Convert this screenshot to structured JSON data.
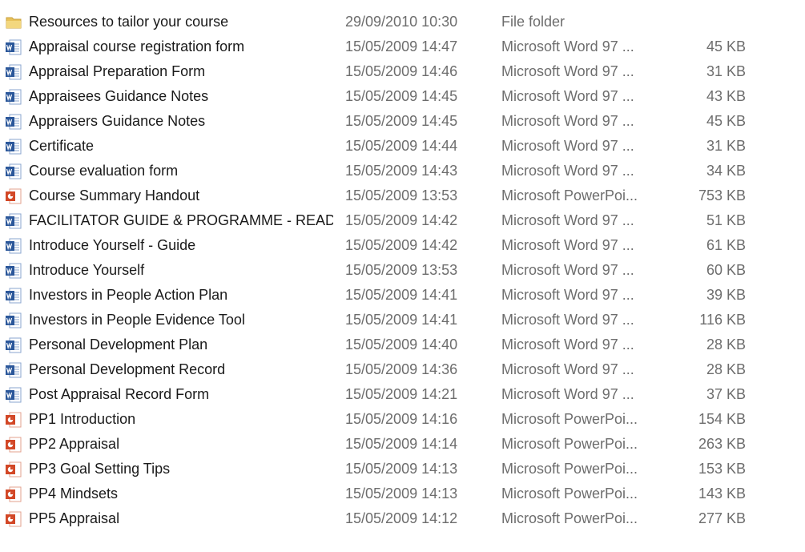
{
  "files": [
    {
      "name": "Resources to tailor your course",
      "date": "29/09/2010 10:30",
      "type": "File folder",
      "size": "",
      "icon": "folder-icon"
    },
    {
      "name": "Appraisal course registration form",
      "date": "15/05/2009 14:47",
      "type": "Microsoft Word 97 ...",
      "size": "45 KB",
      "icon": "word-doc-icon"
    },
    {
      "name": "Appraisal Preparation Form",
      "date": "15/05/2009 14:46",
      "type": "Microsoft Word 97 ...",
      "size": "31 KB",
      "icon": "word-doc-icon"
    },
    {
      "name": "Appraisees Guidance Notes",
      "date": "15/05/2009 14:45",
      "type": "Microsoft Word 97 ...",
      "size": "43 KB",
      "icon": "word-doc-icon"
    },
    {
      "name": "Appraisers Guidance Notes",
      "date": "15/05/2009 14:45",
      "type": "Microsoft Word 97 ...",
      "size": "45 KB",
      "icon": "word-doc-icon"
    },
    {
      "name": "Certificate",
      "date": "15/05/2009 14:44",
      "type": "Microsoft Word 97 ...",
      "size": "31 KB",
      "icon": "word-doc-icon"
    },
    {
      "name": "Course evaluation form",
      "date": "15/05/2009 14:43",
      "type": "Microsoft Word 97 ...",
      "size": "34 KB",
      "icon": "word-doc-icon"
    },
    {
      "name": "Course Summary Handout",
      "date": "15/05/2009 13:53",
      "type": "Microsoft PowerPoi...",
      "size": "753 KB",
      "icon": "powerpoint-icon"
    },
    {
      "name": "FACILITATOR GUIDE & PROGRAMME - READ...",
      "date": "15/05/2009 14:42",
      "type": "Microsoft Word 97 ...",
      "size": "51 KB",
      "icon": "word-doc-icon"
    },
    {
      "name": "Introduce Yourself - Guide",
      "date": "15/05/2009 14:42",
      "type": "Microsoft Word 97 ...",
      "size": "61 KB",
      "icon": "word-doc-icon"
    },
    {
      "name": "Introduce Yourself",
      "date": "15/05/2009 13:53",
      "type": "Microsoft Word 97 ...",
      "size": "60 KB",
      "icon": "word-doc-icon"
    },
    {
      "name": "Investors in People Action Plan",
      "date": "15/05/2009 14:41",
      "type": "Microsoft Word 97 ...",
      "size": "39 KB",
      "icon": "word-doc-icon"
    },
    {
      "name": "Investors in People Evidence Tool",
      "date": "15/05/2009 14:41",
      "type": "Microsoft Word 97 ...",
      "size": "116 KB",
      "icon": "word-doc-icon"
    },
    {
      "name": "Personal Development Plan",
      "date": "15/05/2009 14:40",
      "type": "Microsoft Word 97 ...",
      "size": "28 KB",
      "icon": "word-doc-icon"
    },
    {
      "name": "Personal Development Record",
      "date": "15/05/2009 14:36",
      "type": "Microsoft Word 97 ...",
      "size": "28 KB",
      "icon": "word-doc-icon"
    },
    {
      "name": "Post Appraisal Record Form",
      "date": "15/05/2009 14:21",
      "type": "Microsoft Word 97 ...",
      "size": "37 KB",
      "icon": "word-doc-icon"
    },
    {
      "name": "PP1 Introduction",
      "date": "15/05/2009 14:16",
      "type": "Microsoft PowerPoi...",
      "size": "154 KB",
      "icon": "powerpoint-icon"
    },
    {
      "name": "PP2 Appraisal",
      "date": "15/05/2009 14:14",
      "type": "Microsoft PowerPoi...",
      "size": "263 KB",
      "icon": "powerpoint-icon"
    },
    {
      "name": "PP3 Goal Setting Tips",
      "date": "15/05/2009 14:13",
      "type": "Microsoft PowerPoi...",
      "size": "153 KB",
      "icon": "powerpoint-icon"
    },
    {
      "name": "PP4 Mindsets",
      "date": "15/05/2009 14:13",
      "type": "Microsoft PowerPoi...",
      "size": "143 KB",
      "icon": "powerpoint-icon"
    },
    {
      "name": "PP5 Appraisal",
      "date": "15/05/2009 14:12",
      "type": "Microsoft PowerPoi...",
      "size": "277 KB",
      "icon": "powerpoint-icon"
    }
  ],
  "colors": {
    "folder": "#e8c25a",
    "word": "#2b579a",
    "powerpoint": "#d24726"
  }
}
